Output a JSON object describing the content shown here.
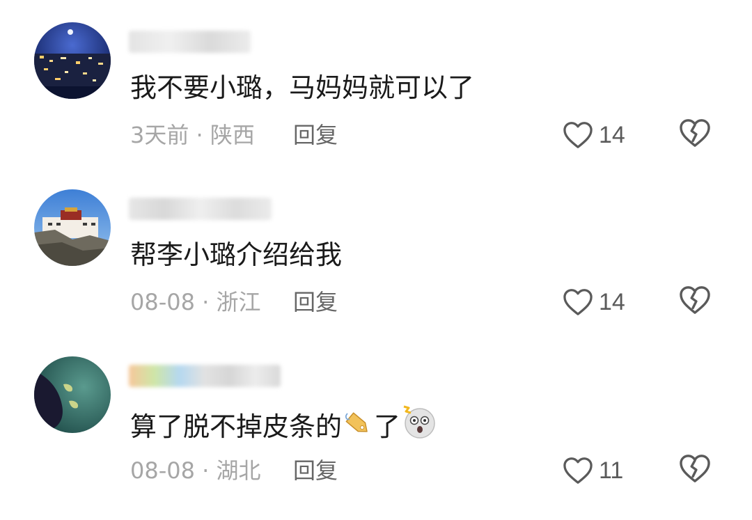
{
  "comments": [
    {
      "text": "我不要小璐，马妈妈就可以了",
      "date": "3天前",
      "location": "陕西",
      "reply_label": "回复",
      "likes": "14",
      "avatar_icon": "night-city-avatar"
    },
    {
      "text": "帮李小璐介绍给我",
      "date": "08-08",
      "location": "浙江",
      "reply_label": "回复",
      "likes": "14",
      "avatar_icon": "potala-palace-avatar"
    },
    {
      "text": "算了脱不掉皮条的",
      "text_after": "了",
      "date": "08-08",
      "location": "湖北",
      "reply_label": "回复",
      "likes": "11",
      "avatar_icon": "dark-teal-avatar"
    }
  ],
  "separator": " · ",
  "colors": {
    "text": "#1a1a1a",
    "meta": "#a6a6a6",
    "icon": "#5a5a5a"
  }
}
